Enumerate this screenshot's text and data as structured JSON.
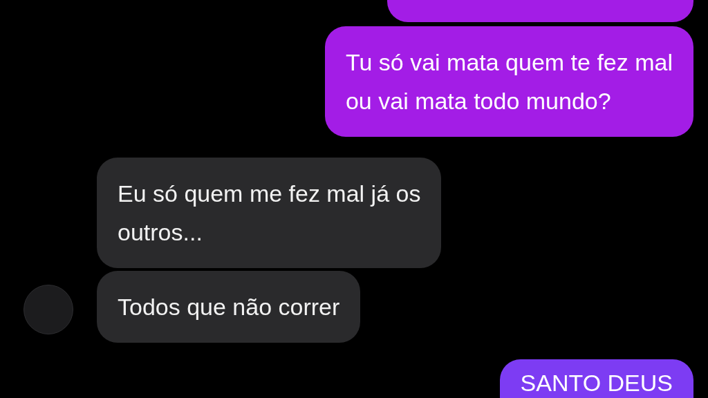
{
  "messages": [
    {
      "kind": "sent",
      "color": "#a31de6"
    },
    {
      "kind": "sent",
      "text": "Tu só vai mata quem te fez mal\nou vai mata todo mundo?",
      "color": "#a31de6"
    },
    {
      "kind": "received",
      "text": "Eu só quem me fez mal já os\noutros...",
      "avatar": false
    },
    {
      "kind": "received",
      "text": "Todos que não correr",
      "avatar": true
    },
    {
      "kind": "sent",
      "text": "SANTO DEUS",
      "color": "#7d3cf3"
    }
  ]
}
